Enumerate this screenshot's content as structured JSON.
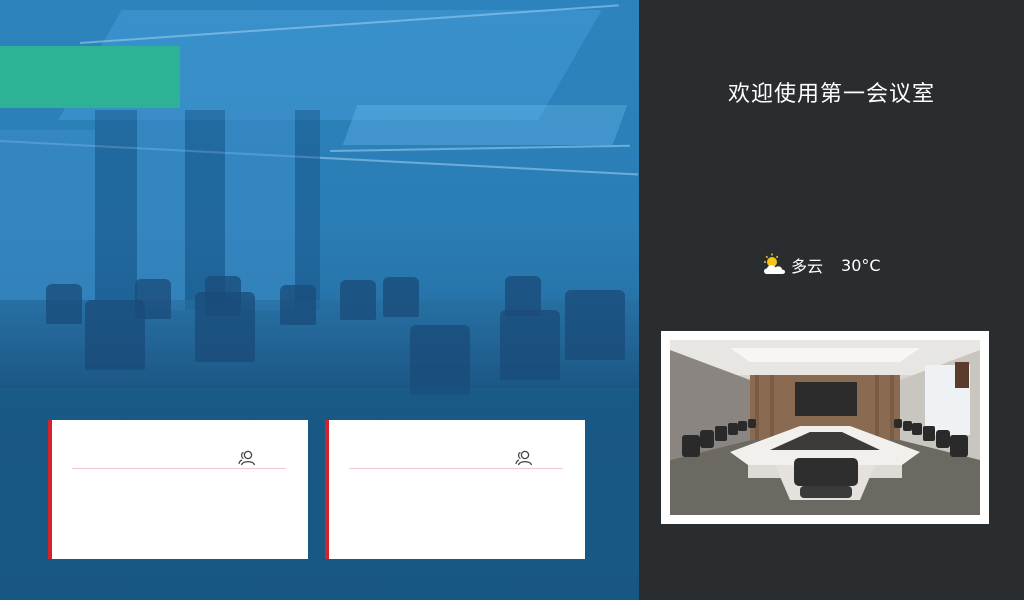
{
  "header": {
    "welcome_text": "欢迎使用第一会议室"
  },
  "weather": {
    "icon": "partly-cloudy-icon",
    "condition": "多云",
    "temperature": "30°C"
  },
  "colors": {
    "left_panel_blue": "#2a7db5",
    "accent_green": "#2db296",
    "card_accent_red": "#d3222b",
    "right_panel_bg": "#2a2d30"
  },
  "cards": [
    {
      "title": "",
      "icon": "people-icon"
    },
    {
      "title": "",
      "icon": "people-icon"
    }
  ],
  "photo": {
    "subject": "conference-room-photo"
  }
}
